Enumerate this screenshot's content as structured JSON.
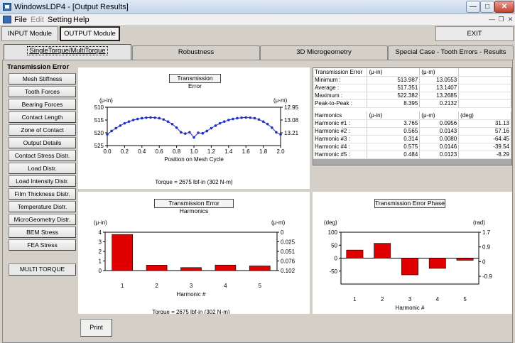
{
  "window": {
    "title": "WindowsLDP4 - [Output Results]"
  },
  "menu": {
    "file": "File",
    "edit": "Edit",
    "setting": "Setting",
    "help": "Help"
  },
  "modules": {
    "input": "INPUT Module",
    "output": "OUTPUT Module",
    "exit": "EXIT"
  },
  "tabs": [
    "SingleTorque/MultiTorque",
    "Robustness",
    "3D Microgeometry",
    "Special Case - Tooth Errors - Results"
  ],
  "sidebar": {
    "title": "Transmission Error",
    "items": [
      "Mesh Stiffness",
      "Tooth Forces",
      "Bearing Forces",
      "Contact Length",
      "Zone of Contact",
      "Output Details",
      "Contact Stress Distr.",
      "Load Distr.",
      "Load Intensity Distr.",
      "Film Thickness Distr.",
      "Temperature Distr.",
      "MicroGeometry Distr.",
      "BEM Stress",
      "FEA Stress"
    ],
    "multi_torque": "MULTI TORQUE"
  },
  "results": {
    "header": {
      "c1": "Transmission Error",
      "c2": "(μ-in)",
      "c3": "(μ-m)"
    },
    "rows": [
      {
        "label": "Minimum :",
        "in": "513.987",
        "m": "13.0553"
      },
      {
        "label": "Average :",
        "in": "517.351",
        "m": "13.1407"
      },
      {
        "label": "Maximum :",
        "in": "522.382",
        "m": "13.2685"
      },
      {
        "label": "Peak-to-Peak :",
        "in": "8.395",
        "m": "0.2132"
      }
    ],
    "harm_header": {
      "c1": "Harmonics",
      "c2": "(μ-in)",
      "c3": "(μ-m)",
      "c4": "(deg)"
    },
    "harmonics": [
      {
        "label": "Harmonic #1 :",
        "in": "3.765",
        "m": "0.0956",
        "deg": "31.13"
      },
      {
        "label": "Harmonic #2 :",
        "in": "0.565",
        "m": "0.0143",
        "deg": "57.16"
      },
      {
        "label": "Harmonic #3 :",
        "in": "0.314",
        "m": "0.0080",
        "deg": "-64.45"
      },
      {
        "label": "Harmonic #4 :",
        "in": "0.575",
        "m": "0.0146",
        "deg": "-39.54"
      },
      {
        "label": "Harmonic #5 :",
        "in": "0.484",
        "m": "0.0123",
        "deg": "-8.29"
      }
    ]
  },
  "print_label": "Print",
  "colors": {
    "te_line": "#1f2fc4",
    "bars": "#e00000"
  },
  "chart_data": [
    {
      "type": "line",
      "title": "Transmission Error",
      "xlabel": "Position on Mesh Cycle",
      "ylabel_left": "(μ-in)",
      "ylabel_right": "(μ-m)",
      "footer": "Torque = 2675 lbf-in (302 N-m)",
      "xlim": [
        0,
        2.0
      ],
      "ylim_left": [
        510,
        525
      ],
      "yticks_left": [
        "510",
        "515",
        "520",
        "525"
      ],
      "yticks_right": [
        "12.95",
        "13.08",
        "13.21"
      ],
      "xticks": [
        "0.0",
        "0.2",
        "0.4",
        "0.6",
        "0.8",
        "1.0",
        "1.2",
        "1.4",
        "1.6",
        "1.8",
        "2.0"
      ],
      "x": [
        0.0,
        0.05,
        0.1,
        0.15,
        0.2,
        0.25,
        0.3,
        0.35,
        0.4,
        0.45,
        0.5,
        0.55,
        0.6,
        0.65,
        0.7,
        0.75,
        0.8,
        0.85,
        0.9,
        0.95,
        1.0,
        1.05,
        1.1,
        1.15,
        1.2,
        1.25,
        1.3,
        1.35,
        1.4,
        1.45,
        1.5,
        1.55,
        1.6,
        1.65,
        1.7,
        1.75,
        1.8,
        1.85,
        1.9,
        1.95,
        2.0
      ],
      "y": [
        520.6,
        519.3,
        518.2,
        517.2,
        516.3,
        515.6,
        515.0,
        514.6,
        514.3,
        514.1,
        514.0,
        514.1,
        514.3,
        514.8,
        515.6,
        516.6,
        518.0,
        519.8,
        520.3,
        519.8,
        521.8,
        520.0,
        520.2,
        519.3,
        518.2,
        517.2,
        516.3,
        515.6,
        515.0,
        514.6,
        514.3,
        514.1,
        514.0,
        514.1,
        514.3,
        514.8,
        515.6,
        516.6,
        518.0,
        519.8,
        520.6
      ]
    },
    {
      "type": "bar",
      "title": "Transmission Error Harmonics",
      "xlabel": "Harmonic #",
      "ylabel_left": "(μ-in)",
      "ylabel_right": "(μ-m)",
      "footer": "Torque = 2675 lbf-in (302 N-m)",
      "categories": [
        "1",
        "2",
        "3",
        "4",
        "5"
      ],
      "values": [
        3.765,
        0.565,
        0.314,
        0.575,
        0.484
      ],
      "ylim": [
        0,
        4
      ],
      "yticks_left": [
        "0",
        "1",
        "2",
        "3",
        "4"
      ],
      "yticks_right": [
        "0",
        "0.025",
        "0.051",
        "0.076",
        "0.102"
      ]
    },
    {
      "type": "bar",
      "title": "Transmission Error Phase",
      "xlabel": "Harmonic #",
      "ylabel_left": "(deg)",
      "ylabel_right": "(rad)",
      "categories": [
        "1",
        "2",
        "3",
        "4",
        "5"
      ],
      "values": [
        31.13,
        57.16,
        -64.45,
        -39.54,
        -8.29
      ],
      "ylim": [
        -100,
        100
      ],
      "yticks_left": [
        "-50",
        "0",
        "50",
        "100"
      ],
      "yticks_right": [
        "1.7",
        "0.9",
        "0",
        "-0.9"
      ]
    }
  ]
}
